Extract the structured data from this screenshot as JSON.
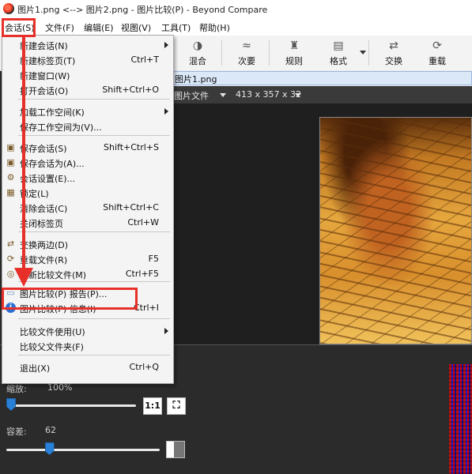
{
  "window": {
    "title": "图片1.png <--> 图片2.png - 图片比较(P) - Beyond Compare"
  },
  "menubar": {
    "items": [
      "会话(S)",
      "文件(F)",
      "编辑(E)",
      "视图(V)",
      "工具(T)",
      "帮助(H)"
    ]
  },
  "toolbar": {
    "buttons": [
      {
        "label": "混合",
        "icon": "blend-icon"
      },
      {
        "label": "次要",
        "icon": "minor-icon"
      },
      {
        "label": "规则",
        "icon": "rules-icon"
      },
      {
        "label": "格式",
        "icon": "format-icon"
      },
      {
        "label": "交换",
        "icon": "swap-icon"
      },
      {
        "label": "重载",
        "icon": "reload-icon"
      }
    ]
  },
  "file": {
    "path": "图片1.png",
    "type_label": "图片文件",
    "dimensions": "413 x 357 x 32"
  },
  "panel": {
    "zoom_label": "缩放:",
    "zoom_value": "100%",
    "ratio_button": "1:1",
    "tolerance_label": "容差:",
    "tolerance_value": "62",
    "zoom_level": 0.0,
    "tolerance_level": 0.25
  },
  "dropdown": {
    "items": [
      {
        "label": "新建会话(N)",
        "shortcut": "",
        "submenu": true,
        "icon": ""
      },
      {
        "label": "新建标签页(T)",
        "shortcut": "Ctrl+T",
        "submenu": false,
        "icon": ""
      },
      {
        "label": "新建窗口(W)",
        "shortcut": "",
        "submenu": false,
        "icon": ""
      },
      {
        "label": "打开会话(O)",
        "shortcut": "Shift+Ctrl+O",
        "submenu": false,
        "icon": ""
      },
      {
        "label": "加载工作空间(K)",
        "shortcut": "",
        "submenu": true,
        "icon": ""
      },
      {
        "label": "保存工作空间为(V)...",
        "shortcut": "",
        "submenu": false,
        "icon": ""
      },
      {
        "label": "保存会话(S)",
        "shortcut": "Shift+Ctrl+S",
        "submenu": false,
        "icon": "save-session-icon"
      },
      {
        "label": "保存会话为(A)...",
        "shortcut": "",
        "submenu": false,
        "icon": "save-as-icon"
      },
      {
        "label": "会话设置(E)...",
        "shortcut": "",
        "submenu": false,
        "icon": "session-settings-icon"
      },
      {
        "label": "锁定(L)",
        "shortcut": "",
        "submenu": false,
        "icon": "lock-icon"
      },
      {
        "label": "清除会话(C)",
        "shortcut": "Shift+Ctrl+C",
        "submenu": false,
        "icon": ""
      },
      {
        "label": "关闭标签页",
        "shortcut": "Ctrl+W",
        "submenu": false,
        "icon": ""
      },
      {
        "label": "交换两边(D)",
        "shortcut": "",
        "submenu": false,
        "icon": "swap-sides-icon"
      },
      {
        "label": "重载文件(R)",
        "shortcut": "F5",
        "submenu": false,
        "icon": "reload-file-icon"
      },
      {
        "label": "重新比较文件(M)",
        "shortcut": "Ctrl+F5",
        "submenu": false,
        "icon": "recompare-icon"
      },
      {
        "label": "图片比较(P) 报告(P)...",
        "shortcut": "",
        "submenu": false,
        "icon": "report-icon"
      },
      {
        "label": "图片比较(P) 信息(I)",
        "shortcut": "Ctrl+I",
        "submenu": false,
        "icon": "info-icon"
      },
      {
        "label": "比较文件使用(U)",
        "shortcut": "",
        "submenu": true,
        "icon": ""
      },
      {
        "label": "比较父文件夹(F)",
        "shortcut": "",
        "submenu": false,
        "icon": ""
      },
      {
        "label": "退出(X)",
        "shortcut": "Ctrl+Q",
        "submenu": false,
        "icon": ""
      }
    ]
  },
  "colors": {
    "annotation_red": "#e8302a",
    "accent_blue": "#2a7fd6"
  }
}
